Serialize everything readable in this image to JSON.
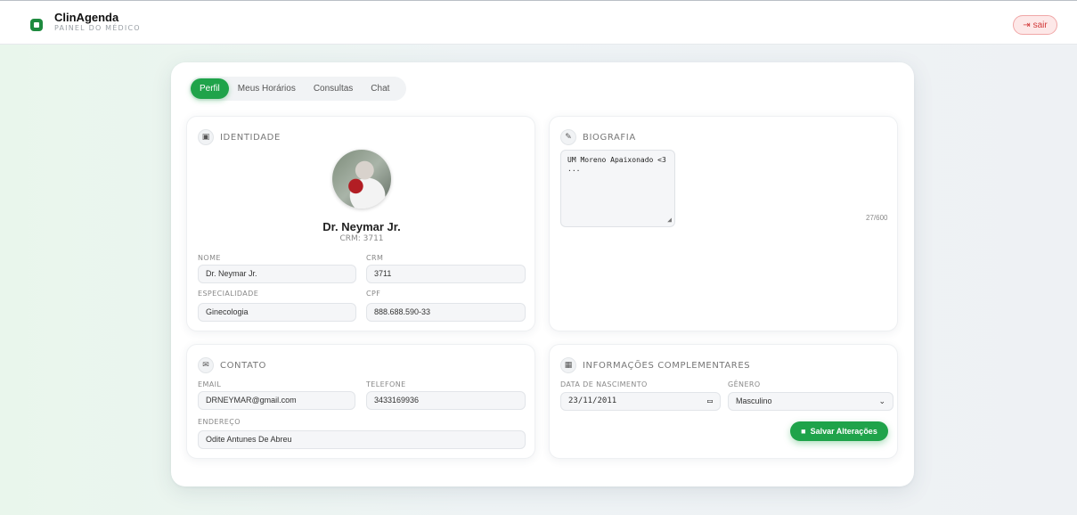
{
  "header": {
    "brand": "ClinAgenda",
    "subtitle": "PAINEL DO MÉDICO",
    "logout_label": "sair",
    "logout_icon": "logout-icon"
  },
  "tabs": [
    {
      "label": "Perfil",
      "active": true
    },
    {
      "label": "Meus Horários",
      "active": false
    },
    {
      "label": "Consultas",
      "active": false
    },
    {
      "label": "Chat",
      "active": false
    }
  ],
  "identity": {
    "title": "IDENTIDADE",
    "icon": "id-card-icon",
    "doctor_name": "Dr. Neymar Jr.",
    "crm_line": "CRM: 3711",
    "fields": {
      "nome_label": "NOME",
      "nome_value": "Dr. Neymar Jr.",
      "crm_label": "CRM",
      "crm_value": "3711",
      "especialidade_label": "ESPECIALIDADE",
      "especialidade_value": "Ginecologia",
      "cpf_label": "CPF",
      "cpf_value": "888.688.590-33"
    }
  },
  "biography": {
    "title": "BIOGRAFIA",
    "icon": "edit-icon",
    "text": "UM Moreno Apaixonado <3 ...",
    "counter": "27/600"
  },
  "contact": {
    "title": "CONTATO",
    "icon": "envelope-icon",
    "email_label": "EMAIL",
    "email_value": "DRNEYMAR@gmail.com",
    "telefone_label": "TELEFONE",
    "telefone_value": "3433169936",
    "endereco_label": "ENDEREÇO",
    "endereco_value": "Odite Antunes De Abreu"
  },
  "extra": {
    "title": "INFORMAÇÕES COMPLEMENTARES",
    "icon": "calendar-icon",
    "nascimento_label": "DATA DE NASCIMENTO",
    "nascimento_value": "23/11/2011",
    "genero_label": "GÊNERO",
    "genero_value": "Masculino",
    "save_label": "Salvar Alterações",
    "save_icon": "floppy-disk-icon"
  },
  "colors": {
    "accent": "#1fa34a",
    "logout_text": "#d23b3b",
    "logout_bg": "#fde8e8"
  }
}
